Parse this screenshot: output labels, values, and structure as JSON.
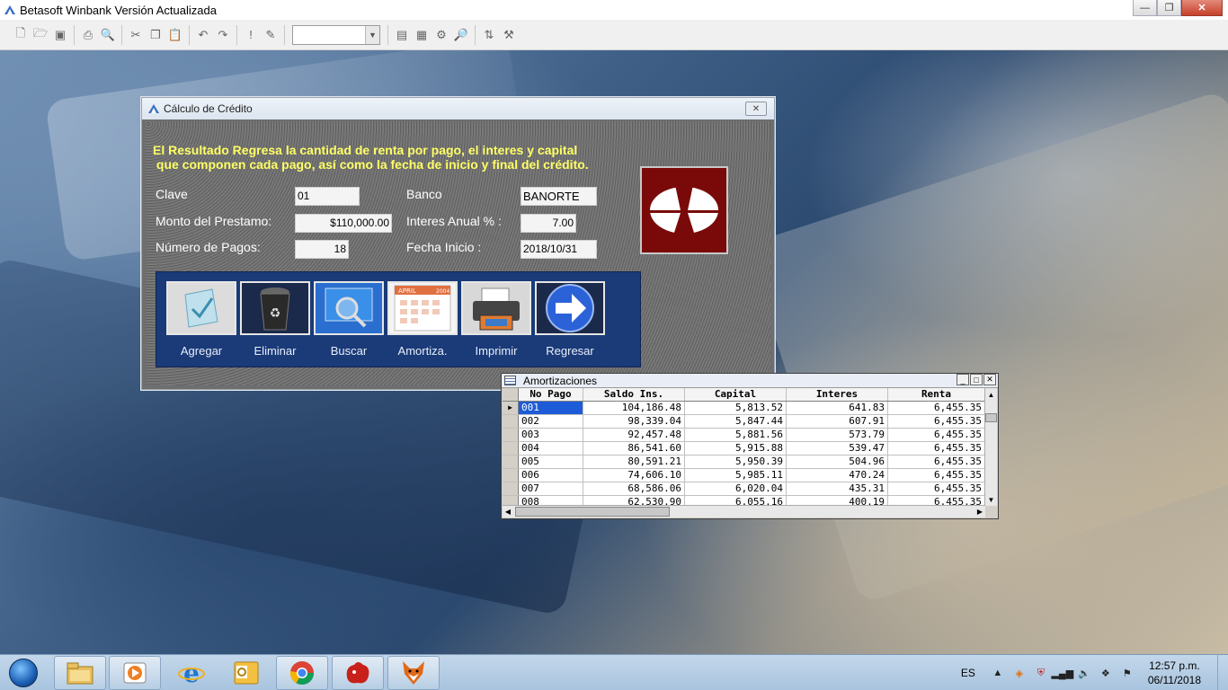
{
  "app": {
    "title": "Betasoft Winbank Versión Actualizada",
    "controls": {
      "minimize": "—",
      "maximize": "❐",
      "close": "✕"
    }
  },
  "toolbar": {
    "icons": [
      "new-icon",
      "open-icon",
      "save-icon",
      "print-icon",
      "print-preview-icon",
      "cut-icon",
      "copy-icon",
      "paste-icon",
      "undo-icon",
      "redo-icon",
      "exclamation-icon",
      "edit-icon",
      "combo",
      "form-icon",
      "report-icon",
      "settings-icon",
      "find-icon",
      "filter-icon",
      "wizard-icon"
    ],
    "combo_value": ""
  },
  "calc": {
    "title": "Cálculo de Crédito",
    "message": "El Resultado Regresa la cantidad de renta por pago, el interes y capital\n que componen cada pago, así como la fecha de inicio y final del crédito.",
    "labels": {
      "clave": "Clave",
      "banco": "Banco",
      "monto": "Monto del Prestamo:",
      "interes": "Interes Anual % :",
      "pagos": "Número de Pagos:",
      "fecha": "Fecha Inicio :"
    },
    "values": {
      "clave": "01",
      "banco": "BANORTE",
      "monto": "$110,000.00",
      "interes": "7.00",
      "pagos": "18",
      "fecha": "2018/10/31"
    },
    "buttons": {
      "agregar": "Agregar",
      "eliminar": "Eliminar",
      "buscar": "Buscar",
      "amortiza": "Amortiza.",
      "imprimir": "Imprimir",
      "regresar": "Regresar"
    },
    "calendar_month": "APRIL",
    "calendar_year": "2004"
  },
  "amort": {
    "title": "Amortizaciones",
    "columns": [
      "No Pago",
      "Saldo Ins.",
      "Capital",
      "Interes",
      "Renta"
    ],
    "rows": [
      [
        "001",
        "104,186.48",
        "5,813.52",
        "641.83",
        "6,455.35"
      ],
      [
        "002",
        "98,339.04",
        "5,847.44",
        "607.91",
        "6,455.35"
      ],
      [
        "003",
        "92,457.48",
        "5,881.56",
        "573.79",
        "6,455.35"
      ],
      [
        "004",
        "86,541.60",
        "5,915.88",
        "539.47",
        "6,455.35"
      ],
      [
        "005",
        "80,591.21",
        "5,950.39",
        "504.96",
        "6,455.35"
      ],
      [
        "006",
        "74,606.10",
        "5,985.11",
        "470.24",
        "6,455.35"
      ],
      [
        "007",
        "68,586.06",
        "6,020.04",
        "435.31",
        "6,455.35"
      ],
      [
        "008",
        "62,530.90",
        "6,055.16",
        "400.19",
        "6,455.35"
      ]
    ]
  },
  "taskbar": {
    "apps": [
      "explorer-icon",
      "media-player-icon",
      "internet-explorer-icon",
      "outlook-icon",
      "chrome-icon",
      "winbank-app-icon",
      "fox-app-icon"
    ],
    "language": "ES",
    "time": "12:57 p.m.",
    "date": "06/11/2018"
  }
}
